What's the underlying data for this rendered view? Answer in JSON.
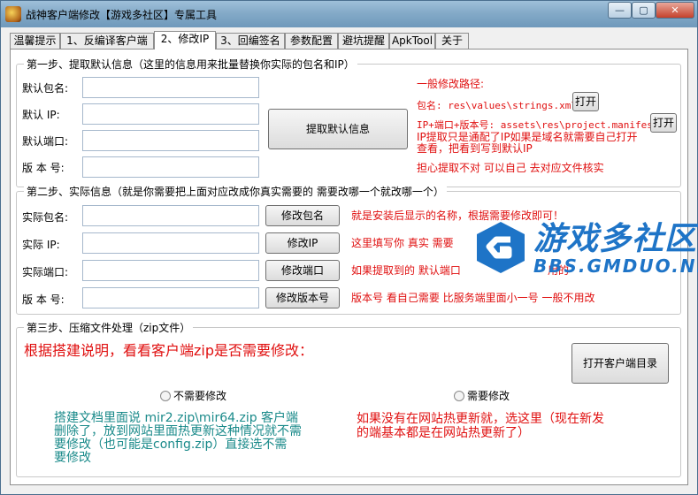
{
  "window": {
    "title": "战神客户端修改【游戏多社区】专属工具",
    "controls": {
      "minimize": "—",
      "maximize": "▢",
      "close": "✕"
    }
  },
  "tabs": [
    "温馨提示",
    "1、反编译客户端",
    "2、修改IP",
    "3、回编签名",
    "参数配置",
    "避坑提醒",
    "ApkTool",
    "关于"
  ],
  "active_tab": "2、修改IP",
  "step1": {
    "title": "第一步、提取默认信息（这里的信息用来批量替换你实际的包名和IP）",
    "labels": [
      "默认包名:",
      "默认 IP:",
      "默认端口:",
      "版 本 号:"
    ],
    "values": [
      "",
      "",
      "",
      ""
    ],
    "extract_button": "提取默认信息",
    "notes": {
      "header": "一般修改路径:",
      "pkg_path": "包名: res\\values\\strings.xml",
      "ip_path": "IP+端口+版本号: assets\\res\\project.manifest",
      "ip_note_1": "IP提取只是通配了IP如果是域名就需要自己打开",
      "ip_note_2": "查看，把看到写到默认IP",
      "worry": "担心提取不对 可以自己  去对应文件核实"
    },
    "open_button": "打开"
  },
  "step2": {
    "title": "第二步、实际信息（就是你需要把上面对应改成你真实需要的 需要改哪一个就改哪一个）",
    "labels": [
      "实际包名:",
      "实际 IP:",
      "实际端口:",
      "版 本 号:"
    ],
    "values": [
      "",
      "",
      "",
      ""
    ],
    "buttons": [
      "修改包名",
      "修改IP",
      "修改端口",
      "修改版本号"
    ],
    "notes": [
      "就是安装后显示的名称，根据需要修改即可！",
      "这里填写你 真实 需要",
      "如果提取到的 默认端口",
      "版本号 看自己需要 比服务端里面小一号 一般不用改"
    ],
    "notes_tail": [
      "就是",
      "用的"
    ]
  },
  "step3": {
    "title": "第三步、压缩文件处理（zip文件）",
    "headline": "根据搭建说明，看看客户端zip是否需要修改：",
    "open_dir_button": "打开客户端目录",
    "radio_no": "不需要修改",
    "radio_yes": "需要修改",
    "left_text": [
      "搭建文档里面说 mir2.zip\\mir64.zip 客户端",
      "删除了，放到网站里面热更新这种情况就不需",
      "要修改（也可能是config.zip）直接选不需",
      "要修改"
    ],
    "right_text": [
      "如果没有在网站热更新就，选这里（现在新发",
      "的端基本都是在网站热更新了）"
    ]
  },
  "watermark": {
    "title": "游戏多社区",
    "url": "BBS.GMDUO.NET"
  },
  "colors": {
    "note_red": "#e01010",
    "teal": "#1a8a8a",
    "watermark_blue": "#1e74c7"
  }
}
